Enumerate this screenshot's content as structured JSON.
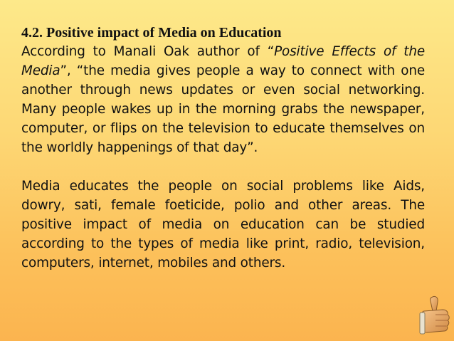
{
  "heading": "4.2. Positive impact of Media on Education",
  "paragraph1": {
    "before_title": "According to Manali Oak author of “",
    "title_italic": "Positive Effects of the Media",
    "after_title": "”, “the media gives people a way to connect with one another through news updates or even social networking. Many people wakes up in the morning grabs the newspaper, computer, or flips on the television to educate themselves on the worldly happenings of that day”."
  },
  "paragraph2": "Media educates the people on social problems like Aids, dowry, sati, female foeticide, polio and other areas. The positive impact of media on education can be studied according to the types of media like print, radio, television, computers, internet, mobiles and others.",
  "icons": {
    "thumb": "thumbs-up-icon"
  },
  "colors": {
    "background_top": "#fde98a",
    "background_bottom": "#fbb44f",
    "text": "#111111"
  }
}
